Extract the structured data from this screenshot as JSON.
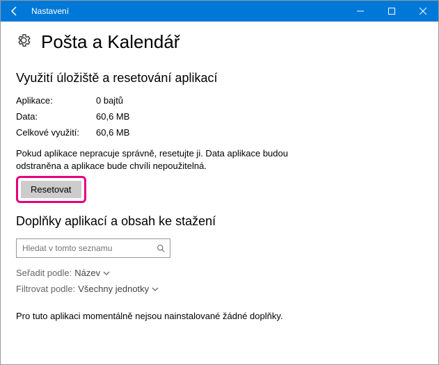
{
  "titlebar": {
    "title": "Nastavení"
  },
  "header": {
    "title": "Pošta a Kalendář"
  },
  "storage": {
    "section_title": "Využití úložiště a resetování aplikací",
    "app_label": "Aplikace:",
    "app_value": "0 bajtů",
    "data_label": "Data:",
    "data_value": "60,6 MB",
    "total_label": "Celkové využití:",
    "total_value": "60,6 MB",
    "description": "Pokud aplikace nepracuje správně, resetujte ji. Data aplikace budou odstraněna a aplikace bude chvíli nepoužitelná.",
    "reset_label": "Resetovat"
  },
  "addons": {
    "section_title": "Doplňky aplikací a obsah ke stažení",
    "search_placeholder": "Hledat v tomto seznamu",
    "sort_label": "Seřadit podle:",
    "sort_value": "Název",
    "filter_label": "Filtrovat podle:",
    "filter_value": "Všechny jednotky",
    "empty_note": "Pro tuto aplikaci momentálně nejsou nainstalované žádné doplňky."
  }
}
